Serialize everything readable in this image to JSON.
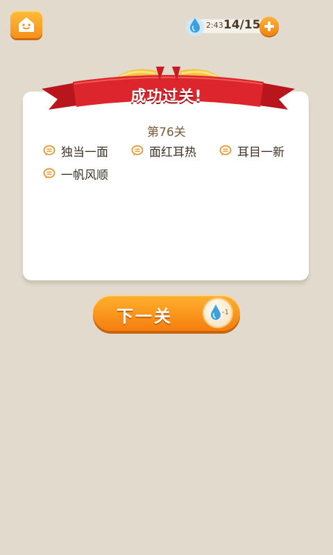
{
  "topbar": {
    "home_icon": "home-face-icon",
    "timer": "2:43",
    "energy": "14/15",
    "plus_icon": "plus-icon",
    "energy_icon": "water-drop-icon"
  },
  "banner": {
    "title": "成功过关!"
  },
  "card": {
    "level": "第76关",
    "idioms": [
      {
        "text": "独当一面"
      },
      {
        "text": "面红耳热"
      },
      {
        "text": "耳目一新"
      },
      {
        "text": "一帆风顺"
      }
    ]
  },
  "next_button": {
    "label": "下一关",
    "cost": "-1",
    "cost_icon": "water-drop-icon"
  },
  "colors": {
    "background": "#e1dacd",
    "accent_orange": "#f7901a",
    "ribbon_red": "#d9232a",
    "ribbon_gold": "#f2c53d"
  }
}
